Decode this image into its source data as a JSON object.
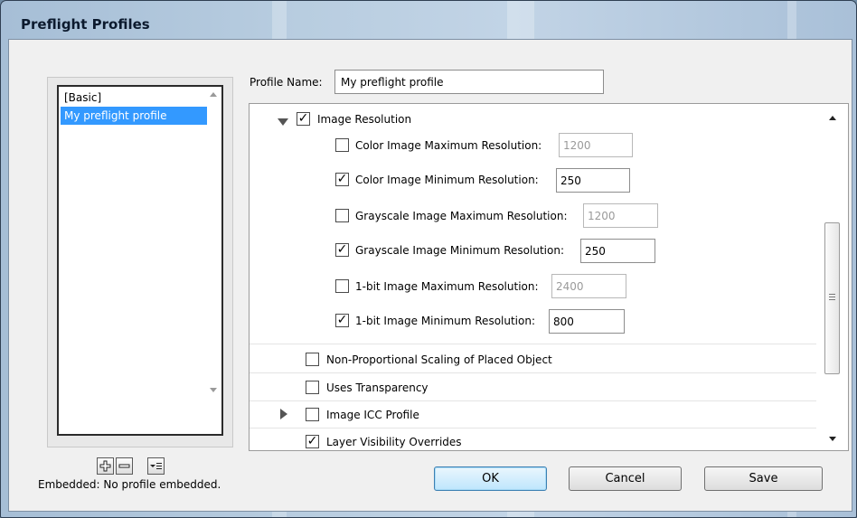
{
  "window": {
    "title": "Preflight Profiles"
  },
  "profiles": {
    "items": [
      "[Basic]",
      "My preflight profile"
    ],
    "selected_index": 1
  },
  "toolbar": {
    "add_icon": "plus-icon",
    "remove_icon": "minus-icon",
    "menu_icon": "list-menu-icon"
  },
  "profile_name": {
    "label": "Profile Name:",
    "value": "My preflight profile"
  },
  "settings": {
    "image_resolution": {
      "label": "Image Resolution",
      "checked": true,
      "expanded": true
    },
    "resolution_rows": [
      {
        "label": "Color Image Maximum Resolution:",
        "checked": false,
        "value": "1200"
      },
      {
        "label": "Color Image Minimum Resolution:",
        "checked": true,
        "value": "250"
      },
      {
        "label": "Grayscale Image Maximum Resolution:",
        "checked": false,
        "value": "1200"
      },
      {
        "label": "Grayscale Image Minimum Resolution:",
        "checked": true,
        "value": "250"
      },
      {
        "label": "1-bit Image Maximum Resolution:",
        "checked": false,
        "value": "2400"
      },
      {
        "label": "1-bit Image Minimum Resolution:",
        "checked": true,
        "value": "800"
      }
    ],
    "other_rows": [
      {
        "label": "Non-Proportional Scaling of Placed Object",
        "checked": false
      },
      {
        "label": "Uses Transparency",
        "checked": false
      },
      {
        "label": "Image ICC Profile",
        "checked": false,
        "expandable": true
      },
      {
        "label": "Layer Visibility Overrides",
        "checked": true
      }
    ]
  },
  "status": {
    "embedded": "Embedded:  No profile embedded."
  },
  "buttons": {
    "ok": "OK",
    "cancel": "Cancel",
    "save": "Save"
  },
  "colors": {
    "selection": "#3399ff",
    "frame": "#b8cde0",
    "dialog": "#f0f0f0"
  }
}
